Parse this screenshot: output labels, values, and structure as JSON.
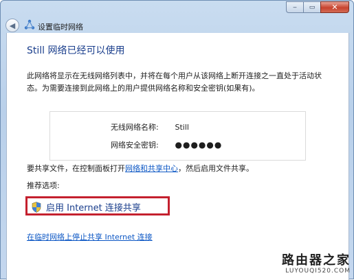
{
  "window": {
    "title": "设置临时网络",
    "controls": {
      "minimize": "‒",
      "maximize": "▭",
      "close": "✕"
    },
    "back_icon": "◀"
  },
  "content": {
    "heading": "Still 网络已经可以使用",
    "description": "此网络将显示在无线网络列表中，并将在每个用户从该网络上断开连接之一直处于活动状态。为需要连接到此网络上的用户提供网络名称和安全密钥(如果有)。",
    "network": {
      "name_label": "无线网络名称:",
      "name_value": "Still",
      "key_label": "网络安全密钥:",
      "key_value": "●●●●●●"
    },
    "share_note": {
      "prefix": "要共享文件，在控制面板打开",
      "link": "网络和共享中心",
      "suffix": "，然后启用文件共享。"
    },
    "recommended_label": "推荐选项:",
    "ics_option": "启用 Internet 连接共享",
    "stop_sharing_link": "在临时网络上停止共享 Internet 连接"
  },
  "watermark": {
    "cn": "路由器之家",
    "en": "LUYOUQI520.COM"
  }
}
